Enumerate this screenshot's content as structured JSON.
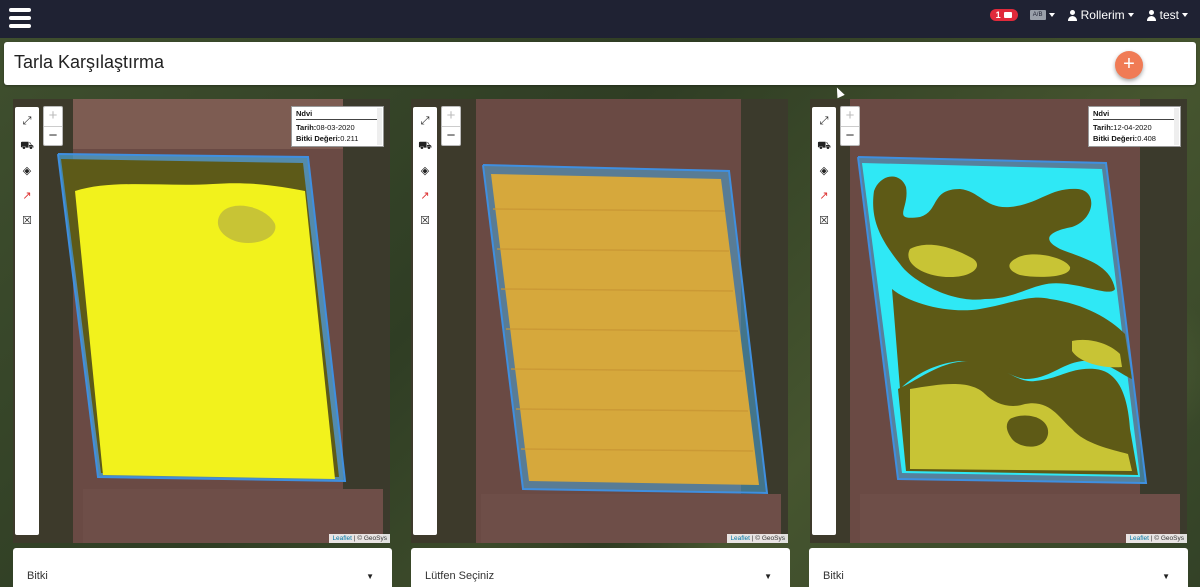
{
  "navbar": {
    "notifications_count": "1",
    "language": "A/B",
    "roles_label": "Rollerim",
    "user_label": "test"
  },
  "page": {
    "title": "Tarla Karşılaştırma",
    "add_label": "+"
  },
  "maps": [
    {
      "info": {
        "name": "Ndvi",
        "date_label": "Tarih:",
        "date": "08-03-2020",
        "value_label": "Bitki Değeri:",
        "value": "0.211"
      },
      "attribution": {
        "leaflet": "Leaflet",
        "sep": " | © GeoSys"
      },
      "select": {
        "value": "Bitki"
      }
    },
    {
      "info": null,
      "attribution": {
        "leaflet": "Leaflet",
        "sep": " | © GeoSys"
      },
      "select": {
        "value": "Lütfen Seçiniz"
      }
    },
    {
      "info": {
        "name": "Ndvi",
        "date_label": "Tarih:",
        "date": "12-04-2020",
        "value_label": "Bitki Değeri:",
        "value": "0.408"
      },
      "attribution": {
        "leaflet": "Leaflet",
        "sep": " | © GeoSys"
      },
      "select": {
        "value": "Bitki"
      }
    }
  ],
  "tools": [
    "expand-arrows-icon",
    "tractor-icon",
    "layers-icon",
    "chart-icon",
    "close-square-icon"
  ],
  "zoom": {
    "in": "+",
    "out": "−"
  },
  "colors": {
    "navbar": "#1f2233",
    "add_button": "#f07b55",
    "badge": "#e02a3b",
    "ndvi_low": "#f2f21c",
    "ndvi_mid": "#c8c435",
    "ndvi_dark": "#5e5a16",
    "ndvi_water": "#2fe8f5",
    "field_outline": "#3f8fe0"
  }
}
